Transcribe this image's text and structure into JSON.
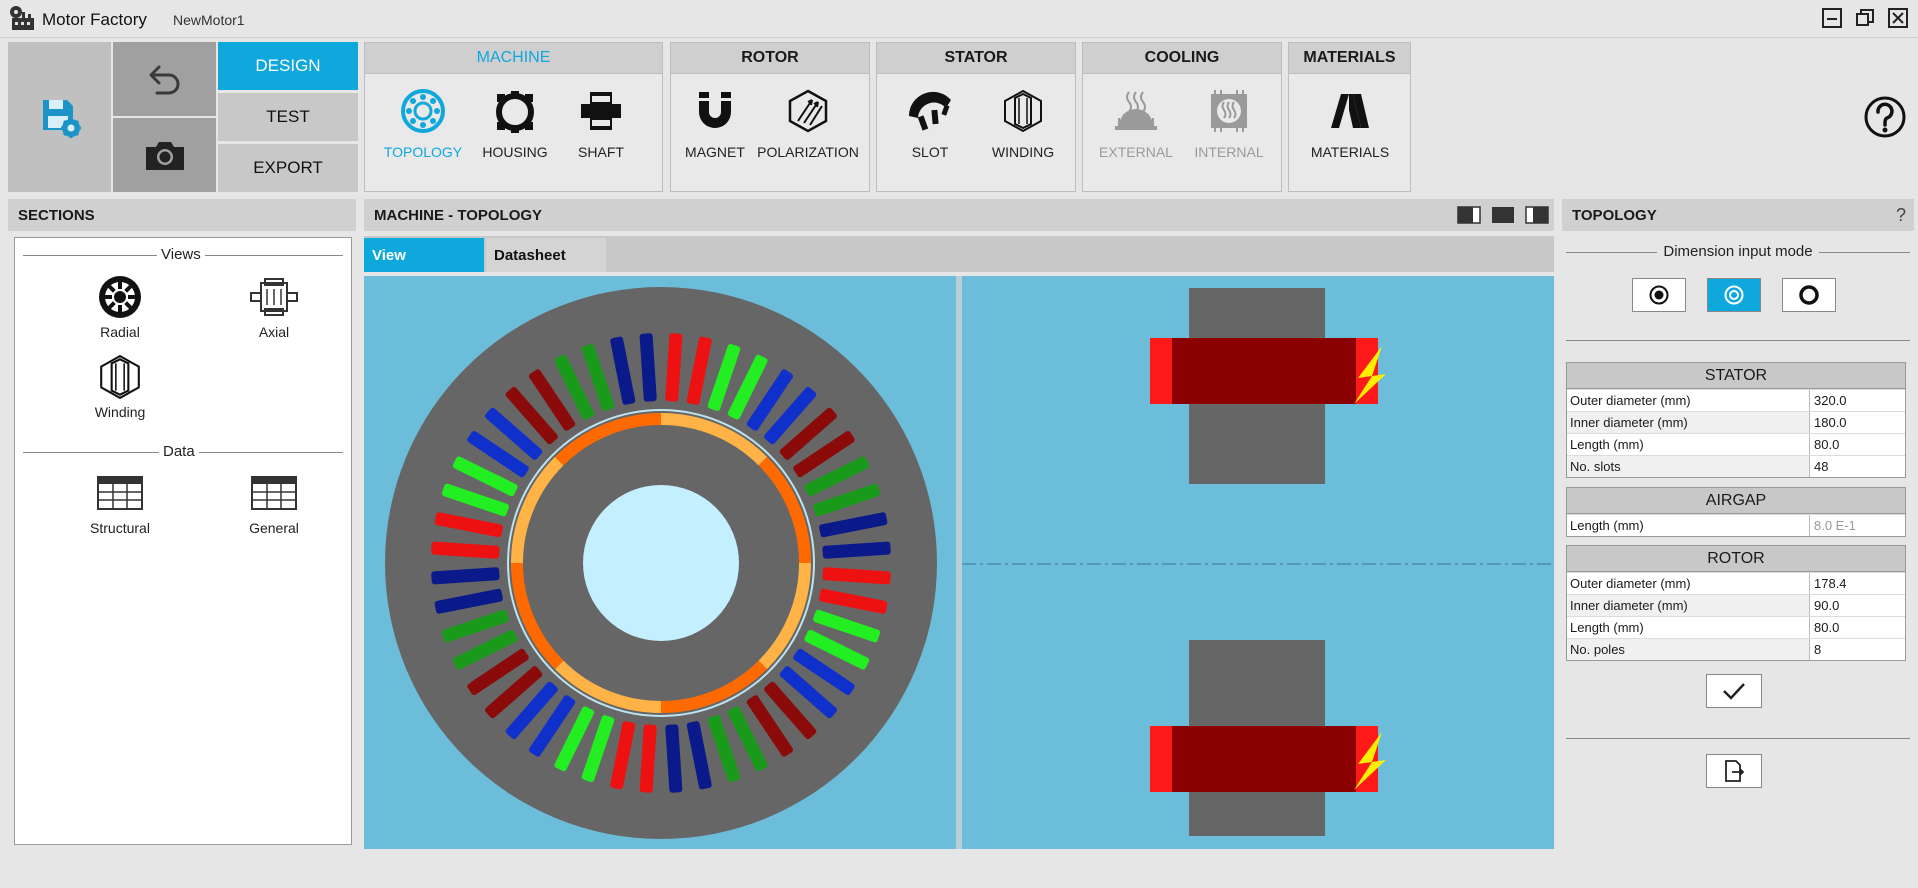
{
  "app": {
    "title": "Motor Factory",
    "document": "NewMotor1"
  },
  "quick": {
    "modes": [
      "DESIGN",
      "TEST",
      "EXPORT"
    ],
    "active_mode": "DESIGN"
  },
  "ribbon": {
    "groups": [
      {
        "title": "MACHINE",
        "tools": [
          "TOPOLOGY",
          "HOUSING",
          "SHAFT"
        ]
      },
      {
        "title": "ROTOR",
        "tools": [
          "MAGNET",
          "POLARIZATION"
        ]
      },
      {
        "title": "STATOR",
        "tools": [
          "SLOT",
          "WINDING"
        ]
      },
      {
        "title": "COOLING",
        "tools": [
          "EXTERNAL",
          "INTERNAL"
        ]
      },
      {
        "title": "MATERIALS",
        "tools": [
          "MATERIALS"
        ]
      }
    ]
  },
  "sections": {
    "title": "SECTIONS",
    "views_label": "Views",
    "views": [
      "Radial",
      "Axial",
      "Winding"
    ],
    "data_label": "Data",
    "data_items": [
      "Structural",
      "General"
    ]
  },
  "center": {
    "title": "MACHINE - TOPOLOGY",
    "tabs": [
      "View",
      "Datasheet"
    ]
  },
  "topology": {
    "title": "TOPOLOGY",
    "help": "?",
    "dim_mode_label": "Dimension input mode",
    "stator": {
      "title": "STATOR",
      "rows": [
        {
          "k": "Outer diameter (mm)",
          "v": "320.0"
        },
        {
          "k": "Inner diameter (mm)",
          "v": "180.0"
        },
        {
          "k": "Length (mm)",
          "v": "80.0"
        },
        {
          "k": "No. slots",
          "v": "48"
        }
      ]
    },
    "airgap": {
      "title": "AIRGAP",
      "rows": [
        {
          "k": "Length (mm)",
          "v": "8.0 E-1"
        }
      ]
    },
    "rotor": {
      "title": "ROTOR",
      "rows": [
        {
          "k": "Outer diameter (mm)",
          "v": "178.4"
        },
        {
          "k": "Inner diameter (mm)",
          "v": "90.0"
        },
        {
          "k": "Length (mm)",
          "v": "80.0"
        },
        {
          "k": "No. poles",
          "v": "8"
        }
      ]
    }
  },
  "colors": {
    "accent": "#0fa8dc",
    "viewport_bg": "#6cbdd9",
    "steel": "#666666",
    "coil_dark": "#8b0000",
    "coil_red": "#ff1a1a",
    "phase_red": "#ee1111",
    "phase_green": "#22ee22",
    "phase_blue": "#1030cc",
    "phase_darkred": "#8b0a0a",
    "phase_darkgreen": "#1a9a1a",
    "phase_darkblue": "#0a1a8a",
    "magnet_orange": "#ff6a00",
    "magnet_light": "#ffb347",
    "bore": "#c4efff",
    "bolt": "#ffee00"
  }
}
